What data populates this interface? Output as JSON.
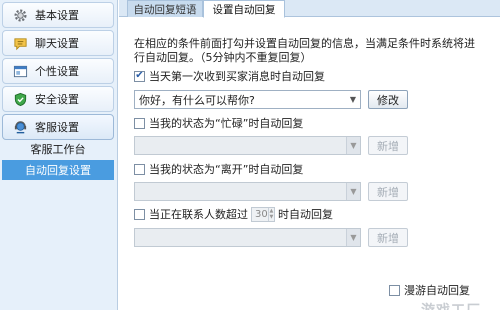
{
  "sidebar": {
    "items": [
      {
        "label": "基本设置",
        "icon": "gear-icon"
      },
      {
        "label": "聊天设置",
        "icon": "chat-icon"
      },
      {
        "label": "个性设置",
        "icon": "window-icon"
      },
      {
        "label": "安全设置",
        "icon": "shield-icon"
      },
      {
        "label": "客服设置",
        "icon": "service-icon"
      }
    ],
    "sub_items": [
      {
        "label": "客服工作台"
      },
      {
        "label": "自动回复设置"
      }
    ]
  },
  "tabs": [
    {
      "label": "自动回复短语"
    },
    {
      "label": "设置自动回复"
    }
  ],
  "description": "在相应的条件前面打勾并设置自动回复的信息，当满足条件时系统将进行自动回复。（5分钟内不重复回复）",
  "rules": {
    "first_message": {
      "label": "当天第一次收到买家消息时自动回复",
      "checked": true,
      "combo_value": "你好，有什么可以帮你?",
      "button": "修改"
    },
    "busy": {
      "label": "当我的状态为“忙碌”时自动回复",
      "checked": false,
      "combo_value": "",
      "button": "新增"
    },
    "away": {
      "label": "当我的状态为“离开”时自动回复",
      "checked": false,
      "combo_value": "",
      "button": "新增"
    },
    "contacts": {
      "label_before": "当正在联系人数超过",
      "count": "30",
      "label_after": "时自动回复",
      "checked": false,
      "combo_value": "",
      "button": "新增"
    }
  },
  "roaming": {
    "label": "漫游自动回复",
    "checked": false
  },
  "watermark": "游戏工厂",
  "colors": {
    "sidebar_bg": "#e6f0fa",
    "selected": "#4a9ce0",
    "tab_bar": "#dbe8f5"
  }
}
